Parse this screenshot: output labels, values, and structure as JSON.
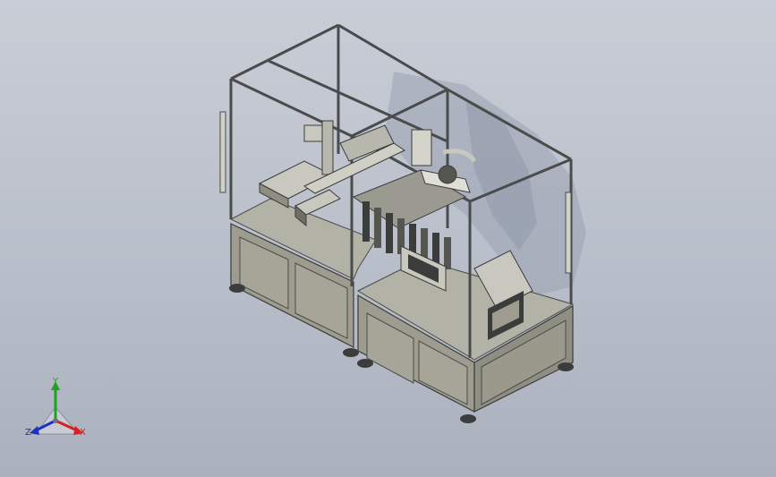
{
  "viewport": {
    "background_top": "#c9cdd6",
    "background_bottom": "#aab0bd"
  },
  "model": {
    "frame_color": "#4a4c4c",
    "cabinet_color": "#9d9c8e",
    "cabinet_dark": "#7f7e72",
    "panel_color": "#a6a597",
    "top_plate_color": "#b3b2a6",
    "shadow_color": "#9aa0ae",
    "mechanism_light": "#c9c8bf",
    "mechanism_dark": "#3b3c3c"
  },
  "triad": {
    "x_label": "X",
    "y_label": "Y",
    "z_label": "Z",
    "x_color": "#d82020",
    "y_color": "#1fa01f",
    "z_color": "#2030c0",
    "icon": "axis-triad-icon"
  }
}
